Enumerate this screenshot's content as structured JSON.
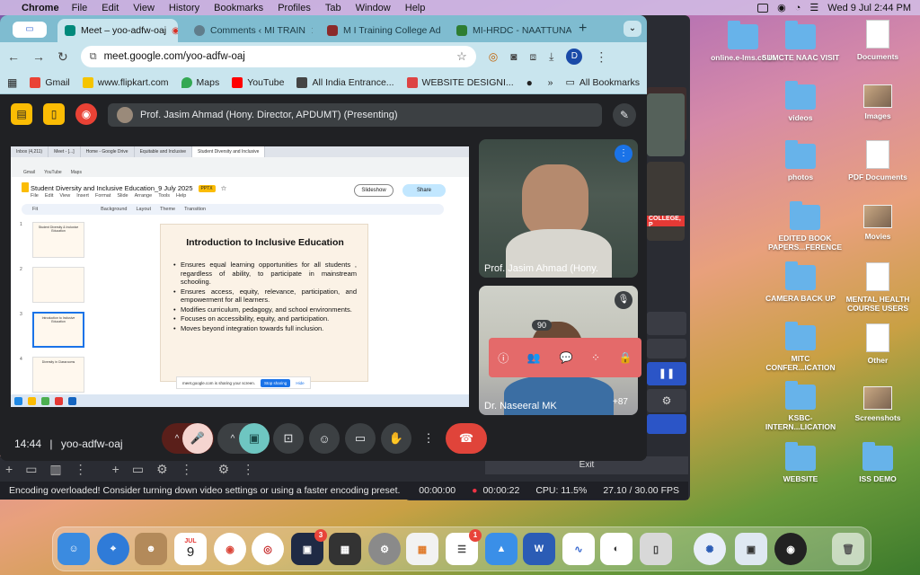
{
  "menubar": {
    "app": "Chrome",
    "items": [
      "File",
      "Edit",
      "View",
      "History",
      "Bookmarks",
      "Profiles",
      "Tab",
      "Window",
      "Help"
    ],
    "datetime": "Wed 9 Jul  2:44 PM"
  },
  "chrome": {
    "tabs": [
      {
        "label": "Meet – yoo-adfw-oaj",
        "active": true
      },
      {
        "label": "Comments ‹ MI TRAIN"
      },
      {
        "label": "M I Training College Ad"
      },
      {
        "label": "MI-HRDC - NAATTUNA"
      }
    ],
    "url": "meet.google.com/yoo-adfw-oaj",
    "profile_initial": "D",
    "bookmarks": [
      "Gmail",
      "www.flipkart.com",
      "Maps",
      "YouTube",
      "All India Entrance...",
      "WEBSITE DESIGNI..."
    ],
    "all_bookmarks": "All Bookmarks"
  },
  "meet": {
    "presenting": "Prof. Jasim Ahmad (Hony. Director, APDUMT) (Presenting)",
    "time": "14:44",
    "code": "yoo-adfw-oaj",
    "participants": [
      {
        "name": "Prof. Jasim Ahmad (Hony."
      },
      {
        "name": "Dr. Naseeral MK"
      }
    ],
    "more_count": "+87",
    "people_count": "90"
  },
  "shared_screen": {
    "doc_title": "Student Diversity and Inclusive Education_9 July 2025",
    "menu": [
      "File",
      "Edit",
      "View",
      "Insert",
      "Format",
      "Slide",
      "Arrange",
      "Tools",
      "Help"
    ],
    "slideshow": "Slideshow",
    "share": "Share",
    "format_items": [
      "Background",
      "Layout",
      "Theme",
      "Transition"
    ],
    "slide_title": "Introduction to Inclusive Education",
    "bullets": [
      "Ensures equal learning opportunities for all students , regardless of ability, to participate in mainstream schooling.",
      "Ensures access, equity, relevance, participation, and empowerment for all learners.",
      "Modifies curriculum, pedagogy, and school environments.",
      "Focuses on accessibility, equity, and participation.",
      "Moves beyond integration towards full inclusion."
    ],
    "share_notice": "meet.google.com is sharing your screen.",
    "stop_sharing": "Stop sharing",
    "hide": "Hide"
  },
  "obs": {
    "status_message": "Encoding overloaded! Consider turning down video settings or using a faster encoding preset.",
    "rec_time_1": "00:00:00",
    "rec_time_2": "00:00:22",
    "cpu": "CPU: 11.5%",
    "fps": "27.10 / 30.00 FPS",
    "exit": "Exit"
  },
  "desktop": {
    "col1": [
      {
        "label": "online.e-lms.co.in",
        "type": "folder"
      },
      {
        "label": "videos",
        "type": "folder"
      },
      {
        "label": "photos",
        "type": "folder"
      },
      {
        "label": "EDITED BOOK PAPERS...FERENCE",
        "type": "folder"
      },
      {
        "label": "CAMERA BACK UP",
        "type": "folder"
      },
      {
        "label": "MITC CONFER...ICATION",
        "type": "folder"
      },
      {
        "label": "KSBC-INTERN...LICATION",
        "type": "folder"
      },
      {
        "label": "WEBSITE",
        "type": "folder"
      }
    ],
    "col2": [
      {
        "label": "SUMCTE NAAC VISIT",
        "type": "folder"
      },
      {
        "label": "Documents",
        "type": "doc"
      },
      {
        "label": "Images",
        "type": "img"
      },
      {
        "label": "PDF Documents",
        "type": "doc"
      },
      {
        "label": "Movies",
        "type": "img"
      },
      {
        "label": "MENTAL HEALTH COURSE USERS",
        "type": "doc"
      },
      {
        "label": "Other",
        "type": "doc"
      },
      {
        "label": "Screenshots",
        "type": "img"
      },
      {
        "label": "ISS DEMO",
        "type": "folder"
      }
    ]
  },
  "dock": {
    "calendar_month": "JUL",
    "calendar_day": "9",
    "badges": {
      "app3": "3",
      "reminders": "1"
    }
  },
  "colors": {
    "accent": "#1a73e8",
    "end_call": "#e0443a",
    "side_panel": "#e46a6a",
    "tabstrip": "#7fbcd0"
  }
}
